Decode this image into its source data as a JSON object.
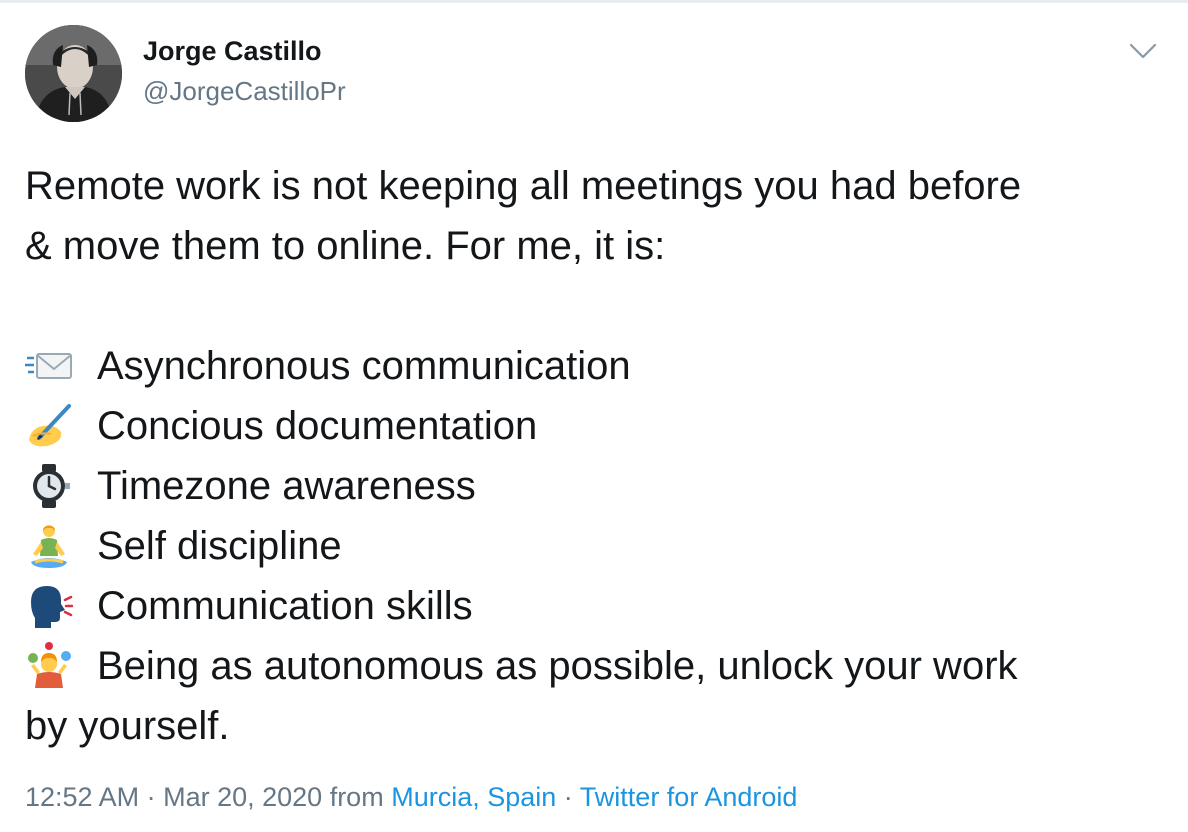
{
  "author": {
    "name": "Jorge Castillo",
    "handle": "@JorgeCastilloPr"
  },
  "tweet": {
    "intro_line1": "Remote work is not keeping all meetings you had before",
    "intro_line2": "& move them to online. For me, it is:",
    "items": [
      {
        "icon": "incoming-envelope-icon",
        "text": "Asynchronous communication"
      },
      {
        "icon": "writing-hand-icon",
        "text": "Concious documentation"
      },
      {
        "icon": "stopwatch-icon",
        "text": "Timezone awareness"
      },
      {
        "icon": "person-lotus-position-icon",
        "text": "Self discipline"
      },
      {
        "icon": "speaking-head-icon",
        "text": "Communication skills"
      },
      {
        "icon": "person-juggling-icon",
        "text": "Being as autonomous as possible, unlock your work"
      }
    ],
    "last_line": "by yourself."
  },
  "meta": {
    "time": "12:52 AM",
    "sep1": " · ",
    "date": "Mar 20, 2020",
    "from_label": " from ",
    "location": "Murcia, Spain",
    "sep2": " · ",
    "source": "Twitter for Android"
  },
  "colors": {
    "text": "#14171a",
    "secondary": "#657786",
    "link": "#1b95e0"
  }
}
